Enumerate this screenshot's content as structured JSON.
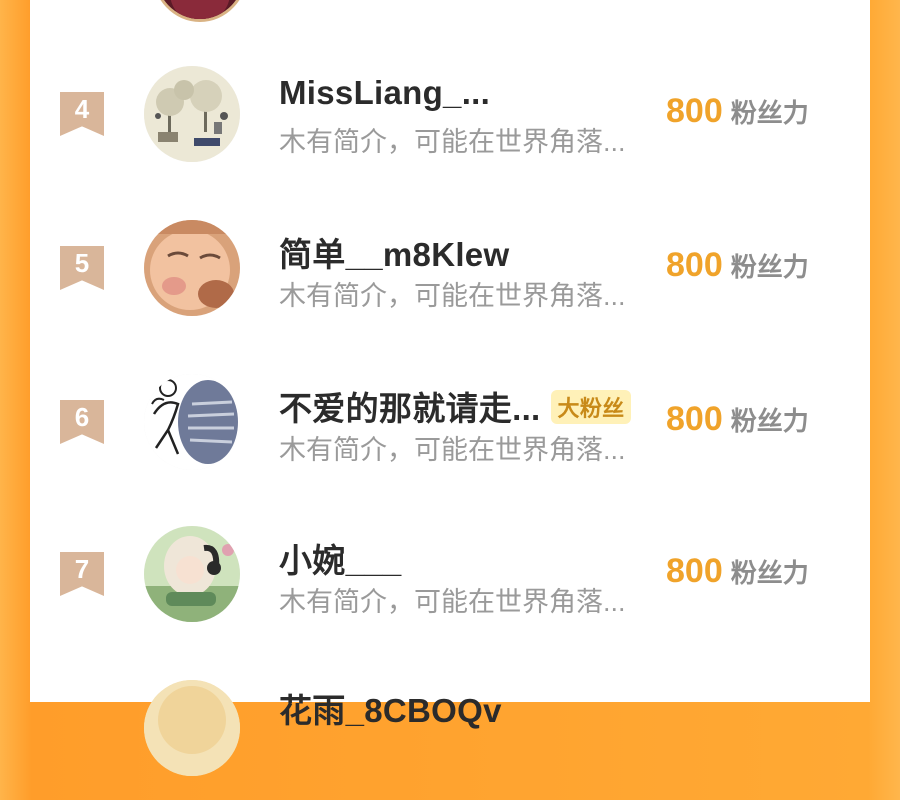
{
  "ranking": {
    "entries": [
      {
        "rank": "4",
        "avatar_icon": "tree-sketch-avatar",
        "name": "MissLiang_...",
        "badge": "",
        "bio": "木有简介，可能在世界角落...",
        "score": "800",
        "score_unit": "粉丝力"
      },
      {
        "rank": "5",
        "avatar_icon": "baby-face-avatar",
        "name": "简单__m8Klew",
        "badge": "",
        "bio": "木有简介，可能在世界角落...",
        "score": "800",
        "score_unit": "粉丝力"
      },
      {
        "rank": "6",
        "avatar_icon": "cartoon-figure-avatar",
        "name": "不爱的那就请走...",
        "badge": "大粉丝",
        "bio": "木有简介，可能在世界角落...",
        "score": "800",
        "score_unit": "粉丝力"
      },
      {
        "rank": "7",
        "avatar_icon": "anime-girl-avatar",
        "name": "小婉___",
        "badge": "",
        "bio": "木有简介，可能在世界角落...",
        "score": "800",
        "score_unit": "粉丝力"
      }
    ],
    "partial_next_name": "花雨_8CBOQv"
  },
  "colors": {
    "background_orange": "#ff9d2a",
    "rank_flag": "#d9b69a",
    "score_orange": "#f0a32a",
    "badge_bg": "#fff1b8"
  }
}
